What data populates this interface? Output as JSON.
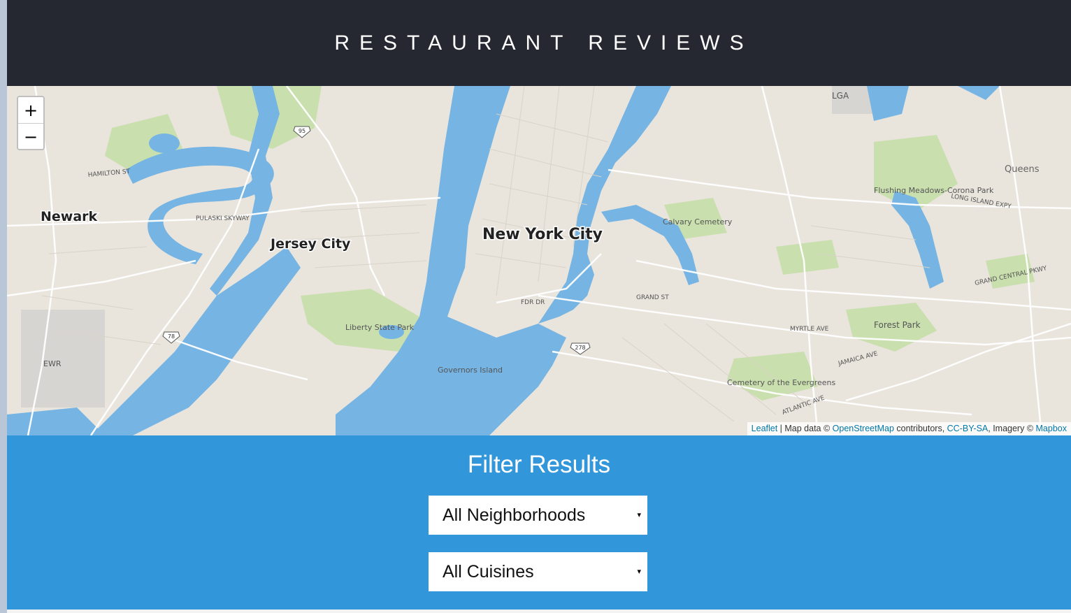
{
  "header": {
    "title": "RESTAURANT REVIEWS"
  },
  "map": {
    "zoom_in_label": "+",
    "zoom_out_label": "−",
    "labels": {
      "newark": "Newark",
      "jersey_city": "Jersey City",
      "new_york_city": "New York City",
      "queens": "Queens",
      "lga": "LGA",
      "ewr": "EWR",
      "liberty_state_park": "Liberty State Park",
      "governors_island": "Governors Island",
      "calvary_cemetery": "Calvary Cemetery",
      "flushing_meadows": "Flushing Meadows-Corona Park",
      "forest_park": "Forest Park",
      "cemetery_evergreens": "Cemetery of the Evergreens",
      "pulaski_skyway": "PULASKI SKYWAY",
      "grand_st": "GRAND ST",
      "myrtle_ave": "MYRTLE AVE",
      "jamaica_ave": "JAMAICA AVE",
      "atlantic_ave": "ATLANTIC AVE",
      "fdr_dr": "FDR DR",
      "long_island_expy": "LONG ISLAND EXPY",
      "grand_central_pkwy": "GRAND CENTRAL PKWY",
      "hamilton_st": "HAMILTON ST",
      "route_95": "95",
      "route_78": "78",
      "route_278": "278"
    },
    "attribution": {
      "leaflet": "Leaflet",
      "sep1": " | Map data © ",
      "osm": "OpenStreetMap",
      "contributors": " contributors, ",
      "license": "CC-BY-SA",
      "imagery": ", Imagery © ",
      "mapbox": "Mapbox"
    }
  },
  "filters": {
    "title": "Filter Results",
    "neighborhoods": {
      "selected": "All Neighborhoods"
    },
    "cuisines": {
      "selected": "All Cuisines"
    },
    "caret": "▾"
  },
  "colors": {
    "header_bg": "#252831",
    "filter_bg": "#3296db",
    "water": "#75b4e3",
    "park": "#c9dfae",
    "land": "#e9e4dc"
  }
}
